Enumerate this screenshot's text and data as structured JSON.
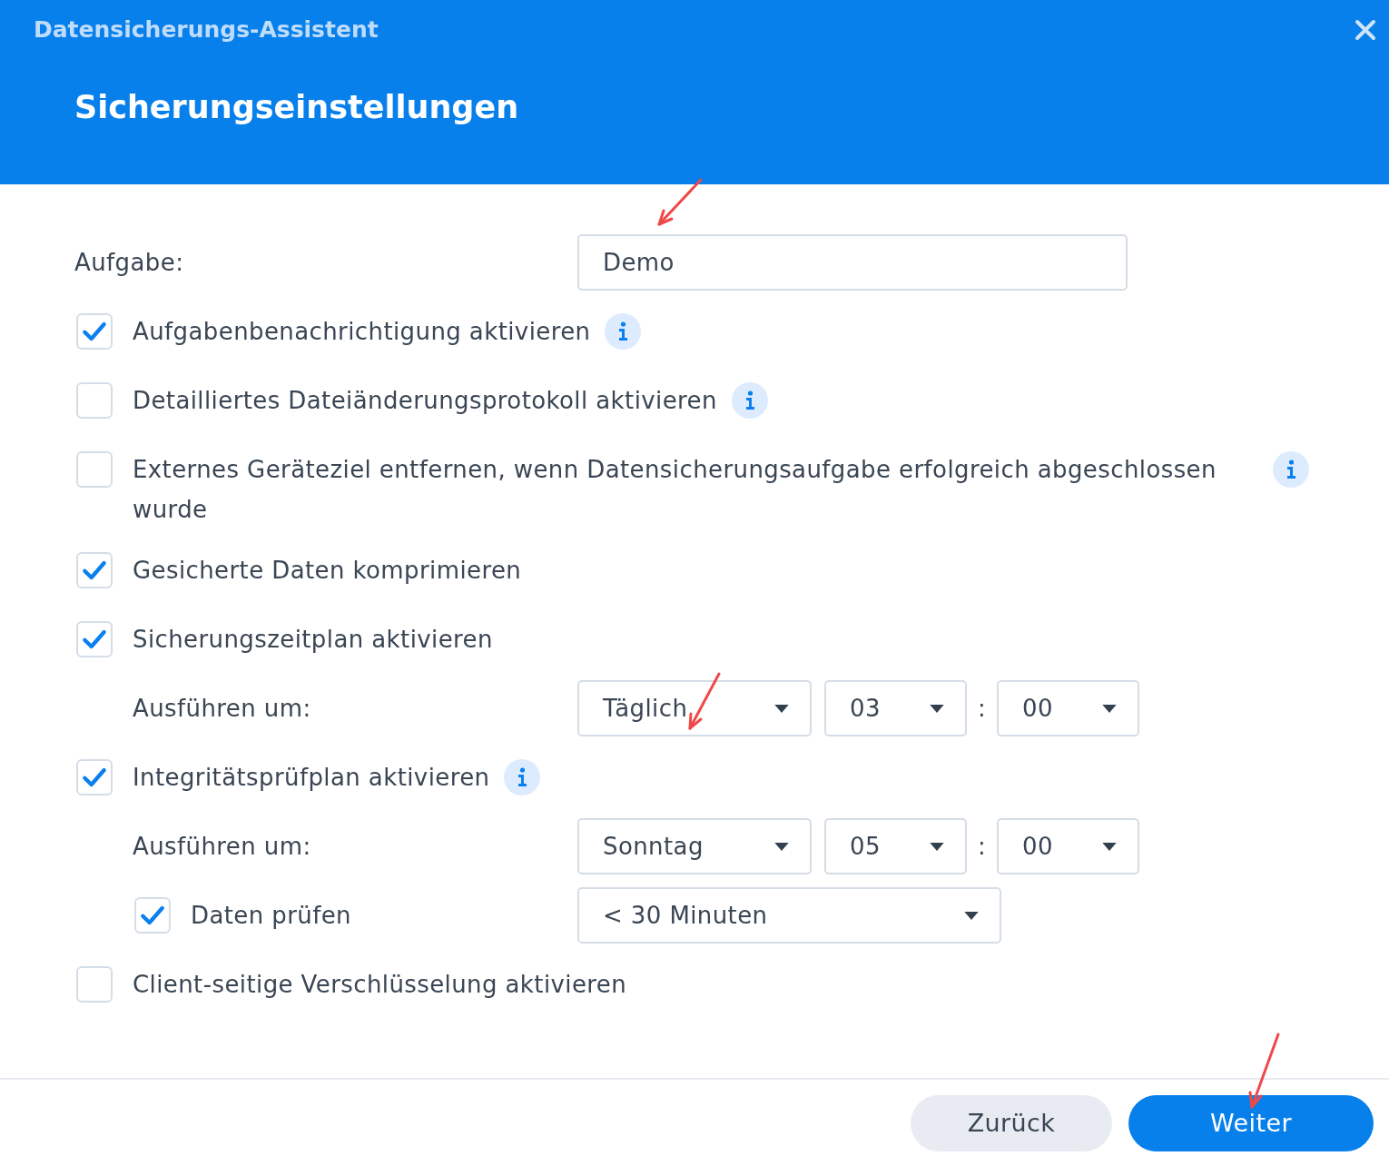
{
  "window": {
    "title": "Datensicherungs-Assistent"
  },
  "page_title": "Sicherungseinstellungen",
  "task": {
    "label": "Aufgabe:",
    "value": "Demo"
  },
  "options": [
    {
      "kind": "checkbox",
      "label": "Aufgabenbenachrichtigung aktivieren",
      "checked": true,
      "info": true
    },
    {
      "kind": "checkbox",
      "label": "Detailliertes Dateiänderungsprotokoll aktivieren",
      "checked": false,
      "info": true
    },
    {
      "kind": "checkbox",
      "label": "Externes Geräteziel entfernen, wenn Datensicherungsaufgabe erfolgreich abgeschlossen wurde",
      "checked": false,
      "info": true
    },
    {
      "kind": "checkbox",
      "label": "Gesicherte Daten komprimieren",
      "checked": true,
      "info": false
    },
    {
      "kind": "checkbox",
      "label": "Sicherungszeitplan aktivieren",
      "checked": true,
      "info": false
    },
    {
      "kind": "schedule",
      "label": "Ausführen um:",
      "selects": [
        "Täglich",
        "03",
        "00"
      ],
      "separator": ":"
    },
    {
      "kind": "checkbox",
      "label": "Integritätsprüfplan aktivieren",
      "checked": true,
      "info": true
    },
    {
      "kind": "schedule",
      "label": "Ausführen um:",
      "selects": [
        "Sonntag",
        "05",
        "00"
      ],
      "separator": ":"
    },
    {
      "kind": "sub-checkbox",
      "label": "Daten prüfen",
      "checked": true,
      "select": "< 30 Minuten"
    },
    {
      "kind": "checkbox",
      "label": "Client-seitige Verschlüsselung aktivieren",
      "checked": false,
      "info": false
    }
  ],
  "buttons": [
    {
      "label": "Zurück",
      "kind": "secondary"
    },
    {
      "label": "Weiter",
      "kind": "primary"
    }
  ]
}
